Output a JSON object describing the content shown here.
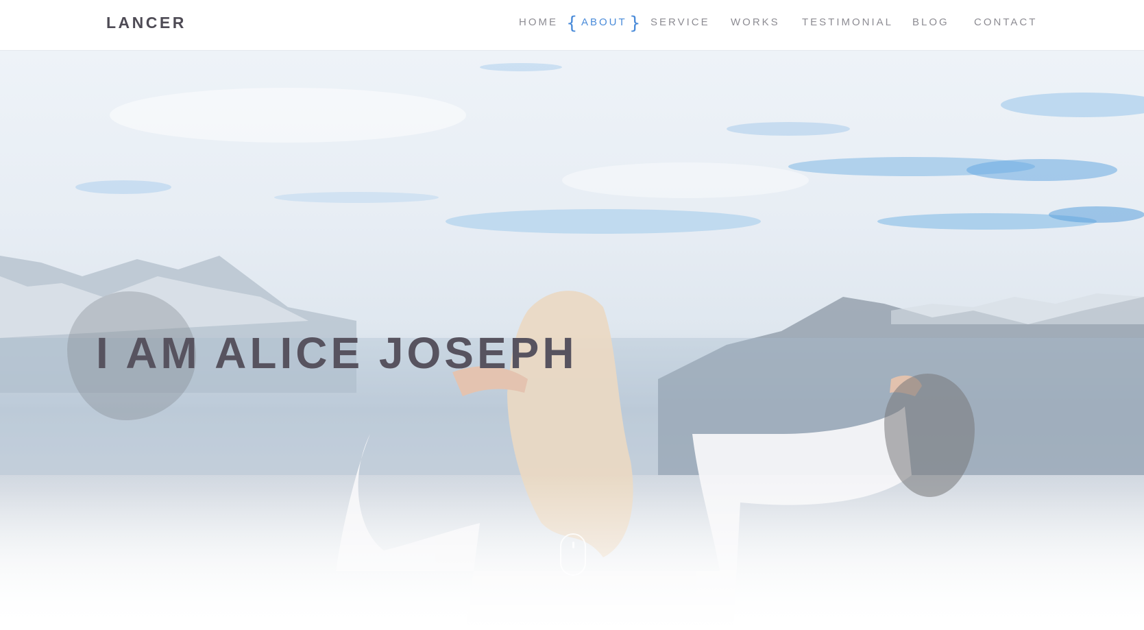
{
  "brand": {
    "name": "LANCER"
  },
  "nav": {
    "items": [
      {
        "label": "HOME"
      },
      {
        "label": "ABOUT"
      },
      {
        "label": "SERVICE"
      },
      {
        "label": "WORKS"
      },
      {
        "label": "TESTIMONIAL"
      },
      {
        "label": "BLOG"
      },
      {
        "label": "CONTACT"
      }
    ],
    "active_item": "ABOUT"
  },
  "hero": {
    "title": "I AM ALICE JOSEPH",
    "background_icon": "mountain-sky-photo-with-woman",
    "scroll_icon": "mouse-scroll-icon"
  },
  "colors": {
    "accent": "#4a8bd9",
    "text_dark": "#57535f",
    "nav_text": "#8d8c93",
    "brand_text": "#4e4b55"
  }
}
